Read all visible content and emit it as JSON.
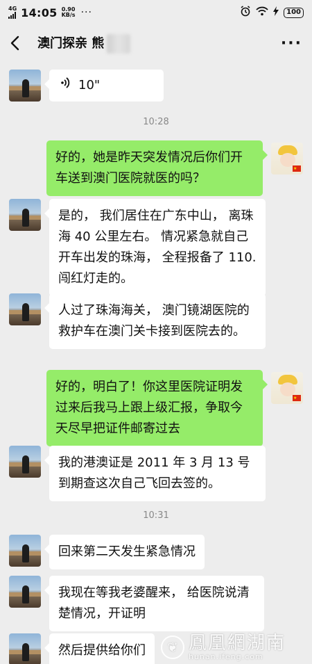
{
  "status_bar": {
    "network": "4G",
    "time": "14:05",
    "speed_value": "0.90",
    "speed_unit": "KB/s",
    "dots": "···",
    "battery": "100"
  },
  "header": {
    "title": "澳门探亲 熊",
    "back_icon": "chevron-left-icon",
    "more_icon": "more-dots-icon",
    "more_label": "···"
  },
  "messages": {
    "m1": {
      "side": "left",
      "voice_label": "10\""
    },
    "t1": "10:28",
    "m2": {
      "side": "right",
      "text": "好的，她是昨天突发情况后你们开车送到澳门医院就医的吗？"
    },
    "m3": {
      "side": "left",
      "text": "是的， 我们居住在广东中山， 离珠海 40 公里左右。 情况紧急就自己开车出发的珠海， 全程报备了 110. 闯红灯走的。"
    },
    "m4": {
      "side": "left",
      "text": "人过了珠海海关， 澳门镜湖医院的救护车在澳门关卡接到医院去的。"
    },
    "m5": {
      "side": "right",
      "text": "好的，明白了！你这里医院证明发过来后我马上跟上级汇报，争取今天尽早把证件邮寄过去"
    },
    "m6": {
      "side": "left",
      "text": "我的港澳证是 2011 年 3 月 13 号到期查这次自己飞回去签的。"
    },
    "t2": "10:31",
    "m7": {
      "side": "left",
      "text": "回来第二天发生紧急情况"
    },
    "m8": {
      "side": "left",
      "text": "我现在等我老婆醒来， 给医院说清楚情况，开证明"
    },
    "m9": {
      "side": "left",
      "text": "然后提供给你们"
    }
  },
  "watermark": {
    "main": "鳳凰網湖南",
    "sub": "hunan.ifeng.com"
  },
  "colors": {
    "background": "#ededed",
    "bubble_left": "#ffffff",
    "bubble_right": "#95ec69",
    "time_label": "#888888"
  }
}
